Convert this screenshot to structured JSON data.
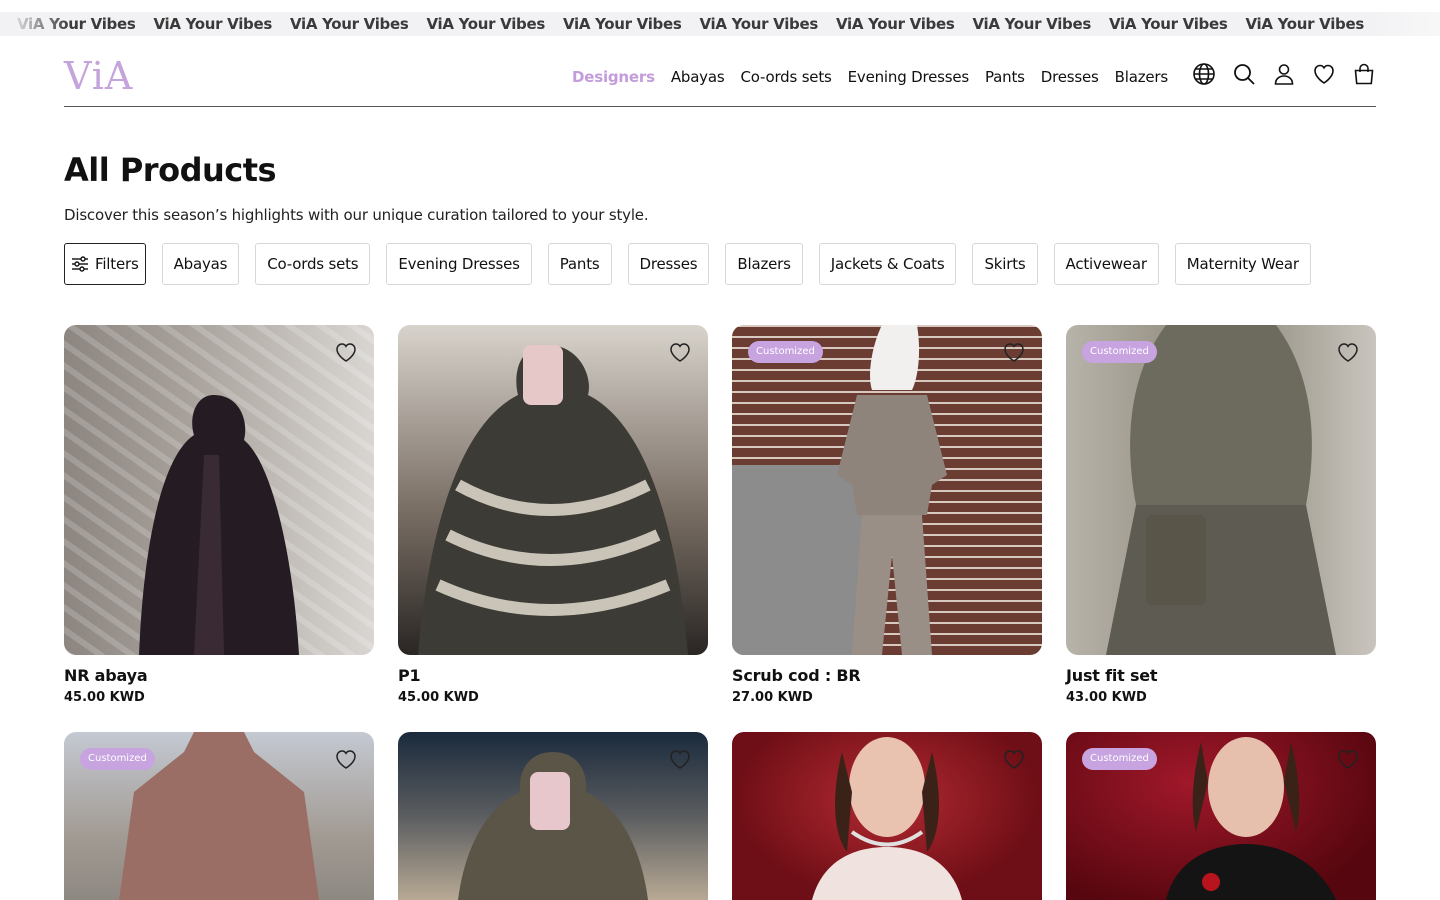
{
  "marquee": {
    "items": [
      "ViA Your Vibes",
      "ViA Your Vibes",
      "ViA Your Vibes",
      "ViA Your Vibes",
      "ViA Your Vibes",
      "ViA Your Vibes",
      "ViA Your Vibes",
      "ViA Your Vibes",
      "ViA Your Vibes",
      "ViA Your Vibes",
      "ViA Your Vibes"
    ]
  },
  "header": {
    "logo": "ViA",
    "nav": [
      "Designers",
      "Abayas",
      "Co-ords sets",
      "Evening Dresses",
      "Pants",
      "Dresses",
      "Blazers"
    ],
    "active_nav": "Designers",
    "icons": [
      "globe-icon",
      "search-icon",
      "user-icon",
      "heart-icon",
      "bag-icon"
    ]
  },
  "page": {
    "title": "All Products",
    "subtitle": "Discover this season’s highlights with our unique curation tailored to your style."
  },
  "filters": {
    "button_label": "Filters",
    "chips": [
      "Abayas",
      "Co-ords sets",
      "Evening Dresses",
      "Pants",
      "Dresses",
      "Blazers",
      "Jackets & Coats",
      "Skirts",
      "Activewear",
      "Maternity Wear"
    ]
  },
  "products": [
    {
      "name": "NR abaya",
      "price": "45.00 KWD",
      "badge": ""
    },
    {
      "name": "P1",
      "price": "45.00 KWD",
      "badge": ""
    },
    {
      "name": "Scrub cod : BR",
      "price": "27.00 KWD",
      "badge": "Customized"
    },
    {
      "name": "Just fit set",
      "price": "43.00 KWD",
      "badge": "Customized"
    },
    {
      "name": "",
      "price": "",
      "badge": "Customized"
    },
    {
      "name": "",
      "price": "",
      "badge": ""
    },
    {
      "name": "",
      "price": "",
      "badge": ""
    },
    {
      "name": "",
      "price": "",
      "badge": "Customized"
    }
  ],
  "colors": {
    "accent": "#c39ddb",
    "badge_bg": "#c7a3e0",
    "text": "#111111"
  }
}
